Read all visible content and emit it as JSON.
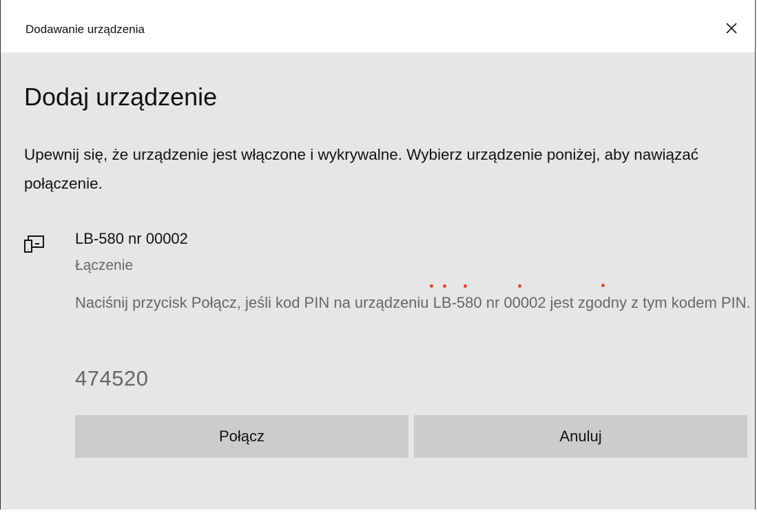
{
  "window": {
    "title": "Dodawanie urządzenia",
    "close_icon": "close-icon"
  },
  "main": {
    "heading": "Dodaj urządzenie",
    "description": "Upewnij się, że urządzenie jest włączone i wykrywalne. Wybierz urządzenie poniżej, aby nawiązać połączenie."
  },
  "device": {
    "icon": "device-icon",
    "name": "LB-580 nr 00002",
    "status": "Łączenie",
    "info": "Naciśnij przycisk Połącz, jeśli kod PIN na urządzeniu LB-580 nr 00002 jest zgodny z tym kodem PIN.",
    "pin": "474520"
  },
  "buttons": {
    "connect_label": "Połącz",
    "cancel_label": "Anuluj"
  },
  "colors": {
    "background": "#e6e6e6",
    "button": "#cccccc",
    "secondary_text": "#666666",
    "marker_dots": "#e54133"
  }
}
